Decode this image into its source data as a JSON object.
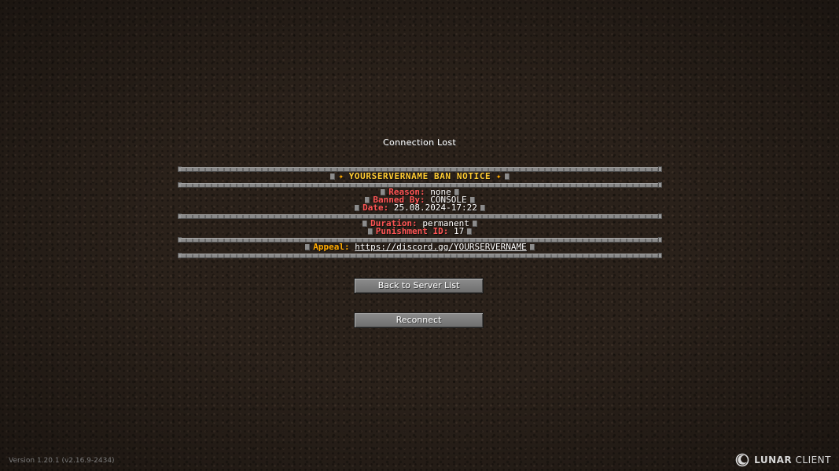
{
  "screen": {
    "title": "Connection Lost"
  },
  "notice": {
    "header": "YOURSERVERNAME BAN NOTICE",
    "star_glyph": "✦",
    "reason_label": "Reason:",
    "reason_value": "none",
    "banned_by_label": "Banned By:",
    "banned_by_value": "CONSOLE",
    "date_label": "Date:",
    "date_value": "25.08.2024-17:22",
    "duration_label": "Duration:",
    "duration_value": "permanent",
    "punishment_label": "Punishment ID:",
    "punishment_value": "17",
    "appeal_label": "Appeal:",
    "appeal_value": "https://discord.gg/YOURSERVERNAME"
  },
  "buttons": {
    "back": "Back to Server List",
    "reconnect": "Reconnect"
  },
  "footer": {
    "version": "Version 1.20.1 (v2.16.9-2434)",
    "brand_strong": "LUNAR",
    "brand_light": "CLIENT",
    "brand_icon": "lunar-moon-icon"
  },
  "colors": {
    "label_red": "#ff5555",
    "header_gold": "#ffcc33",
    "appeal_orange": "#ffaa00"
  }
}
